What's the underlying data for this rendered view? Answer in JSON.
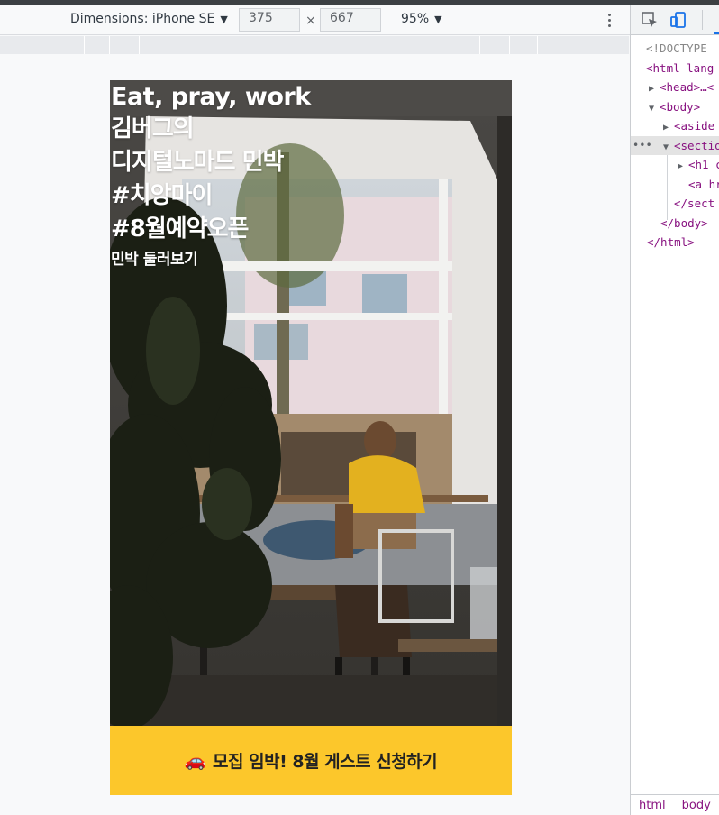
{
  "device_toolbar": {
    "dimensions_label": "Dimensions: iPhone SE",
    "width_value": "375",
    "times": "×",
    "height_value": "667",
    "zoom_label": "95%"
  },
  "page": {
    "hero_lines": [
      "Eat, pray, work",
      "김버그의",
      "디지털노마드 민박",
      "#치앙마이",
      "#8월예약오픈"
    ],
    "hero_link": "민박 둘러보기",
    "cta_emoji": "🚗",
    "cta_label": "모집 임박! 8월 게스트 신청하기",
    "cta_color": "#fcc72b"
  },
  "devtools": {
    "lines": [
      {
        "indent": 0,
        "text": "<!DOCTYPE"
      },
      {
        "indent": 0,
        "text": "<html lang"
      },
      {
        "indent": 1,
        "text": "<head>…<"
      },
      {
        "indent": 1,
        "text": "<body>"
      },
      {
        "indent": 2,
        "text": "<aside"
      },
      {
        "indent": 2,
        "text": "<sectio"
      },
      {
        "indent": 3,
        "text": "<h1 c"
      },
      {
        "indent": 3,
        "text": "<a hr"
      },
      {
        "indent": 2,
        "text": "</sect"
      },
      {
        "indent": 1,
        "text": "</body>"
      },
      {
        "indent": 0,
        "text": "</html>"
      }
    ],
    "breadcrumb": [
      "html",
      "body"
    ]
  }
}
